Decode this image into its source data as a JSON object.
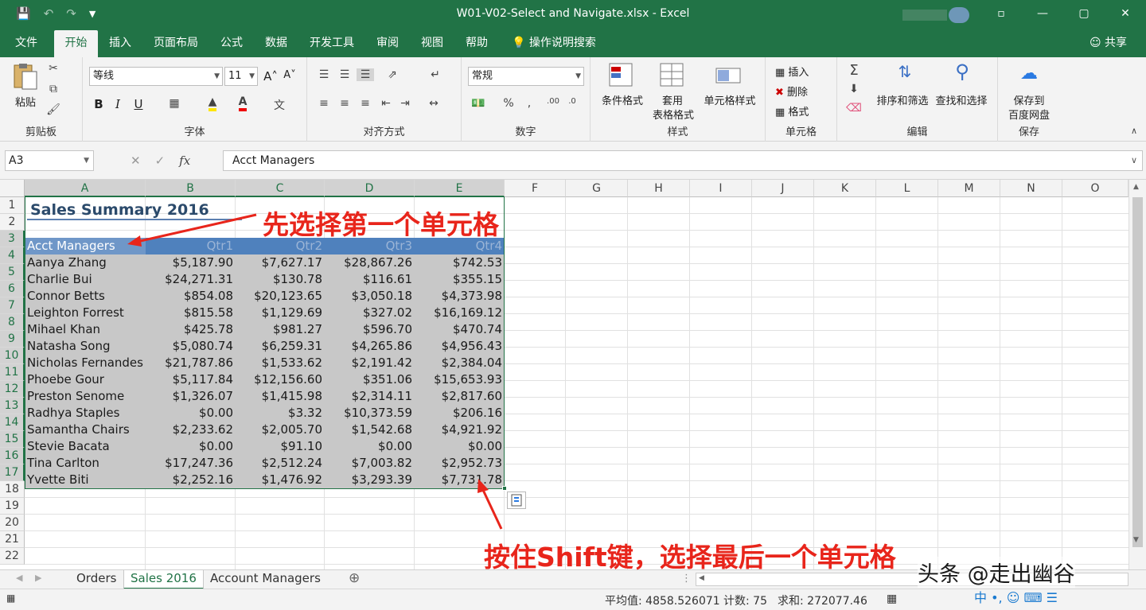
{
  "window": {
    "title": "W01-V02-Select and Navigate.xlsx  -  Excel",
    "qat": [
      "save-icon",
      "undo-icon",
      "redo-icon",
      "customize-icon"
    ],
    "controls": [
      "—",
      "▢",
      "✕"
    ],
    "ribbon_display": "▫"
  },
  "menu": {
    "tabs": [
      "文件",
      "开始",
      "插入",
      "页面布局",
      "公式",
      "数据",
      "开发工具",
      "审阅",
      "视图",
      "帮助"
    ],
    "active": "开始",
    "tellme": "操作说明搜索",
    "share": "共享"
  },
  "ribbon": {
    "clipboard": {
      "label": "剪贴板",
      "paste": "粘贴"
    },
    "font": {
      "label": "字体",
      "name": "等线",
      "size": "11",
      "bold": "B",
      "italic": "I",
      "underline": "U",
      "grow": "A˄",
      "shrink": "A˅"
    },
    "alignment": {
      "label": "对齐方式"
    },
    "number": {
      "label": "数字",
      "format": "常规"
    },
    "styles": {
      "label": "样式",
      "conditional": "条件格式",
      "table_1": "套用",
      "table_2": "表格格式",
      "cell": "单元格样式"
    },
    "cells": {
      "label": "单元格",
      "insert": "插入",
      "delete": "删除",
      "format": "格式"
    },
    "editing": {
      "label": "编辑",
      "sort": "排序和筛选",
      "find": "查找和选择"
    },
    "save": {
      "label": "保存",
      "btn_1": "保存到",
      "btn_2": "百度网盘"
    }
  },
  "formula_bar": {
    "name_box": "A3",
    "content": "Acct Managers"
  },
  "grid": {
    "columns": [
      "A",
      "B",
      "C",
      "D",
      "E",
      "F",
      "G",
      "H",
      "I",
      "J",
      "K",
      "L",
      "M",
      "N",
      "O"
    ],
    "rows": [
      "1",
      "2",
      "3",
      "4",
      "5",
      "6",
      "7",
      "8",
      "9",
      "10",
      "11",
      "12",
      "13",
      "14",
      "15",
      "16",
      "17",
      "18",
      "19",
      "20",
      "21",
      "22"
    ],
    "title": "Sales Summary 2016",
    "header": [
      "Acct Managers",
      "Qtr1",
      "Qtr2",
      "Qtr3",
      "Qtr4"
    ],
    "data": [
      [
        "Aanya Zhang",
        "$5,187.90",
        "$7,627.17",
        "$28,867.26",
        "$742.53"
      ],
      [
        "Charlie Bui",
        "$24,271.31",
        "$130.78",
        "$116.61",
        "$355.15"
      ],
      [
        "Connor Betts",
        "$854.08",
        "$20,123.65",
        "$3,050.18",
        "$4,373.98"
      ],
      [
        "Leighton Forrest",
        "$815.58",
        "$1,129.69",
        "$327.02",
        "$16,169.12"
      ],
      [
        "Mihael Khan",
        "$425.78",
        "$981.27",
        "$596.70",
        "$470.74"
      ],
      [
        "Natasha Song",
        "$5,080.74",
        "$6,259.31",
        "$4,265.86",
        "$4,956.43"
      ],
      [
        "Nicholas Fernandes",
        "$21,787.86",
        "$1,533.62",
        "$2,191.42",
        "$2,384.04"
      ],
      [
        "Phoebe Gour",
        "$5,117.84",
        "$12,156.60",
        "$351.06",
        "$15,653.93"
      ],
      [
        "Preston Senome",
        "$1,326.07",
        "$1,415.98",
        "$2,314.11",
        "$2,817.60"
      ],
      [
        "Radhya Staples",
        "$0.00",
        "$3.32",
        "$10,373.59",
        "$206.16"
      ],
      [
        "Samantha Chairs",
        "$2,233.62",
        "$2,005.70",
        "$1,542.68",
        "$4,921.92"
      ],
      [
        "Stevie Bacata",
        "$0.00",
        "$91.10",
        "$0.00",
        "$0.00"
      ],
      [
        "Tina Carlton",
        "$17,247.36",
        "$2,512.24",
        "$7,003.82",
        "$2,952.73"
      ],
      [
        "Yvette Biti",
        "$2,252.16",
        "$1,476.92",
        "$3,293.39",
        "$7,731.78"
      ]
    ]
  },
  "sheets": {
    "tabs": [
      "Orders",
      "Sales 2016",
      "Account Managers"
    ],
    "active": "Sales 2016",
    "add": "⊕"
  },
  "status": {
    "average": "平均值: 4858.526071",
    "count": "计数: 75",
    "sum": "求和: 272077.46"
  },
  "annotations": {
    "top": "先选择第一个单元格",
    "bottom": "按住Shift键，选择最后一个单元格"
  },
  "watermark": {
    "text": "头条 @走出幽谷",
    "ime": "中 •, ☺ ⌨ ☰"
  },
  "colors": {
    "excel_green": "#217346",
    "header_fill": "#4f81bd",
    "selection_gray": "#c8c8c8",
    "annotation_red": "#e8251b"
  }
}
